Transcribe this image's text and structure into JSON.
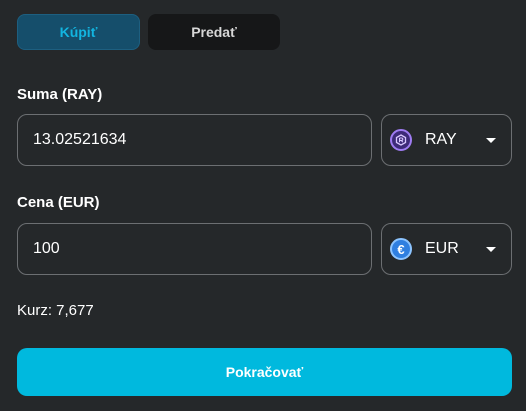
{
  "tabs": {
    "buy_label": "Kúpiť",
    "sell_label": "Predať",
    "active": "buy"
  },
  "amount": {
    "label": "Suma (RAY)",
    "value": "13.02521634",
    "currency": "RAY",
    "currency_icon": "raydium-coin-icon"
  },
  "price": {
    "label": "Cena (EUR)",
    "value": "100",
    "currency": "EUR",
    "currency_icon": "euro-coin-icon"
  },
  "rate": {
    "text": "Kurz: 7,677"
  },
  "continue_label": "Pokračovať",
  "colors": {
    "background": "#25282a",
    "accent": "#00b9de",
    "active_tab_bg": "#154e6b",
    "active_tab_text": "#12b5e0",
    "inactive_tab_bg": "#161718",
    "border": "#6c6f72"
  }
}
